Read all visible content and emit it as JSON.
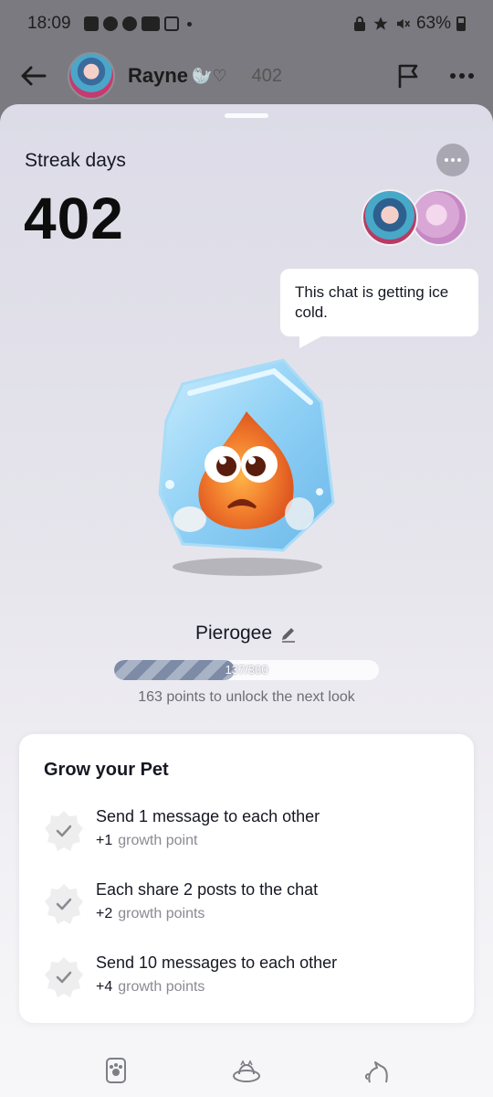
{
  "status_bar": {
    "time": "18:09",
    "battery": "63%",
    "left_icons": [
      "gallery-icon",
      "tiktok-icon",
      "pinterest-icon",
      "youtube-icon",
      "instagram-icon"
    ],
    "right_icons": [
      "lock-icon",
      "star-icon",
      "mute-icon"
    ]
  },
  "header": {
    "name": "Rayne",
    "emoji": "🦭♡",
    "streak_count": "402"
  },
  "streak": {
    "label": "Streak days",
    "count": "402"
  },
  "bubble": {
    "text": "This chat is getting ice cold."
  },
  "pet": {
    "name": "Pierogee",
    "progress_text": "137/300",
    "progress_fraction": 0.4567,
    "unlock_text": "163 points to unlock the next look"
  },
  "grow": {
    "title": "Grow your Pet",
    "tasks": [
      {
        "title": "Send 1 message to each other",
        "points": "+1",
        "unit": "growth point"
      },
      {
        "title": "Each share 2 posts to the chat",
        "points": "+2",
        "unit": "growth points"
      },
      {
        "title": "Send 10 messages to each other",
        "points": "+4",
        "unit": "growth points"
      }
    ]
  },
  "bottom_nav": [
    "paw-card-icon",
    "pet-bed-icon",
    "pet-cat-icon"
  ],
  "colors": {
    "sheet_top": "#dcdbe7",
    "sheet_bottom": "#f7f7f9",
    "progress_stripe_dark": "#7e8ba6",
    "progress_stripe_light": "#a9b3c6",
    "ice": "#8fd0f5"
  }
}
